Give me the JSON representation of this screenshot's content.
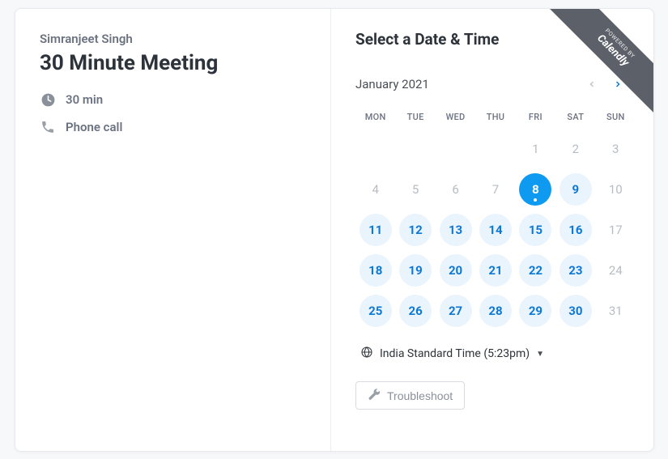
{
  "host_name": "Simranjeet Singh",
  "meeting_title": "30 Minute Meeting",
  "duration_label": "30 min",
  "location_label": "Phone call",
  "select_title": "Select a Date & Time",
  "month_label": "January 2021",
  "weekdays": [
    "MON",
    "TUE",
    "WED",
    "THU",
    "FRI",
    "SAT",
    "SUN"
  ],
  "days": [
    {
      "n": "",
      "s": "empty"
    },
    {
      "n": "",
      "s": "empty"
    },
    {
      "n": "",
      "s": "empty"
    },
    {
      "n": "",
      "s": "empty"
    },
    {
      "n": "1",
      "s": "unavail"
    },
    {
      "n": "2",
      "s": "unavail"
    },
    {
      "n": "3",
      "s": "unavail"
    },
    {
      "n": "4",
      "s": "unavail"
    },
    {
      "n": "5",
      "s": "unavail"
    },
    {
      "n": "6",
      "s": "unavail"
    },
    {
      "n": "7",
      "s": "unavail"
    },
    {
      "n": "8",
      "s": "selected"
    },
    {
      "n": "9",
      "s": "avail"
    },
    {
      "n": "10",
      "s": "unavail"
    },
    {
      "n": "11",
      "s": "avail"
    },
    {
      "n": "12",
      "s": "avail"
    },
    {
      "n": "13",
      "s": "avail"
    },
    {
      "n": "14",
      "s": "avail"
    },
    {
      "n": "15",
      "s": "avail"
    },
    {
      "n": "16",
      "s": "avail"
    },
    {
      "n": "17",
      "s": "unavail"
    },
    {
      "n": "18",
      "s": "avail"
    },
    {
      "n": "19",
      "s": "avail"
    },
    {
      "n": "20",
      "s": "avail"
    },
    {
      "n": "21",
      "s": "avail"
    },
    {
      "n": "22",
      "s": "avail"
    },
    {
      "n": "23",
      "s": "avail"
    },
    {
      "n": "24",
      "s": "unavail"
    },
    {
      "n": "25",
      "s": "avail"
    },
    {
      "n": "26",
      "s": "avail"
    },
    {
      "n": "27",
      "s": "avail"
    },
    {
      "n": "28",
      "s": "avail"
    },
    {
      "n": "29",
      "s": "avail"
    },
    {
      "n": "30",
      "s": "avail"
    },
    {
      "n": "31",
      "s": "unavail"
    }
  ],
  "timezone_label": "India Standard Time (5:23pm)",
  "troubleshoot_label": "Troubleshoot",
  "ribbon_powered": "POWERED BY",
  "ribbon_brand": "Calendly",
  "colors": {
    "accent": "#0e78d5",
    "selected": "#0e9af0",
    "avail_bg": "#eaf4fd"
  }
}
